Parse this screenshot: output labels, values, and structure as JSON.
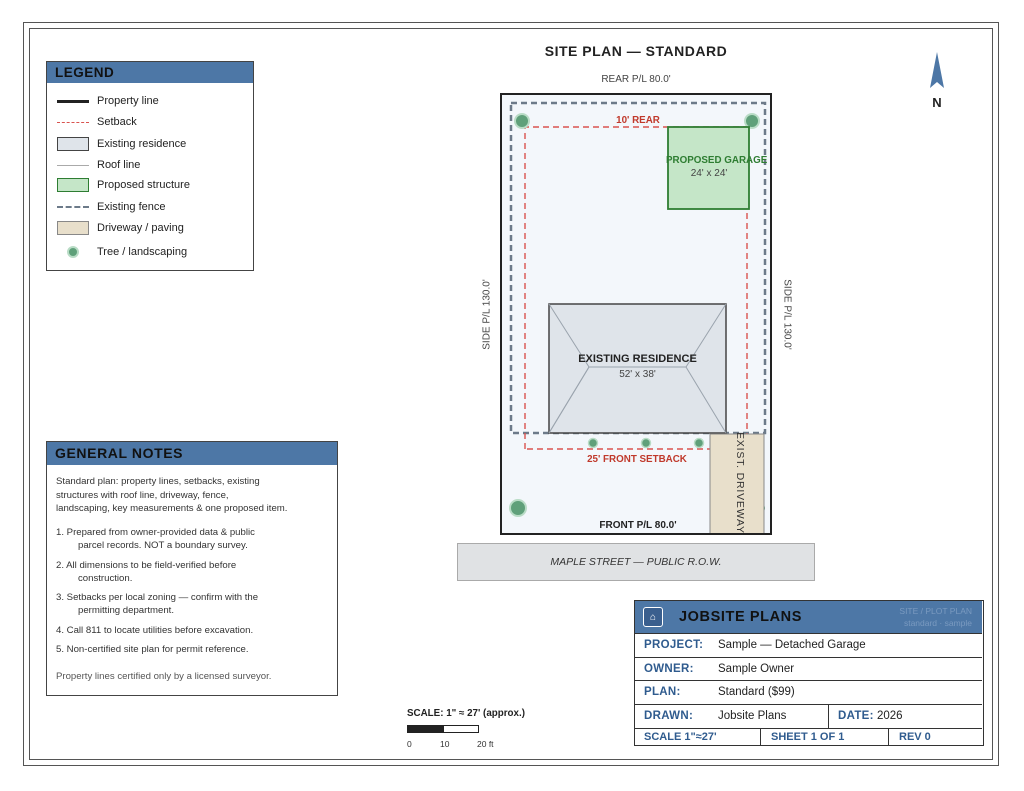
{
  "plan_title": "SITE PLAN — STANDARD",
  "lot": {
    "rear_label": "REAR P/L 80.0'",
    "front_label": "FRONT P/L 80.0'",
    "side_left_label": "SIDE P/L 130.0'",
    "side_right_label": "SIDE P/L 130.0'",
    "rear_setback_label": "10' REAR",
    "front_setback_label": "25' FRONT SETBACK"
  },
  "existing_residence": {
    "name": "EXISTING RESIDENCE",
    "dims": "52' x 38'"
  },
  "proposed_garage": {
    "name": "PROPOSED GARAGE",
    "dims": "24' x 24'"
  },
  "driveway_label": "EXIST. DRIVEWAY",
  "street_label": "MAPLE STREET — PUBLIC R.O.W.",
  "north_label": "N",
  "legend": {
    "title": "LEGEND",
    "items": [
      {
        "label": "Property line",
        "icon": "property-line"
      },
      {
        "label": "Setback",
        "icon": "setback-line"
      },
      {
        "label": "Existing residence",
        "icon": "residence-swatch"
      },
      {
        "label": "Roof line",
        "icon": "roof-line"
      },
      {
        "label": "Proposed structure",
        "icon": "proposed-swatch"
      },
      {
        "label": "Existing fence",
        "icon": "fence-line"
      },
      {
        "label": "Driveway / paving",
        "icon": "driveway-swatch"
      },
      {
        "label": "Tree / landscaping",
        "icon": "tree"
      }
    ]
  },
  "notes": {
    "title": "GENERAL NOTES",
    "intro_lines": [
      "Standard plan: property lines, setbacks, existing",
      "structures with roof line, driveway, fence,",
      "landscaping, key measurements & one proposed item."
    ],
    "items": [
      [
        "1. Prepared from owner-provided data & public",
        "parcel records. NOT a boundary survey."
      ],
      [
        "2. All dimensions to be field-verified before",
        "construction."
      ],
      [
        "3. Setbacks per local zoning — confirm with the",
        "permitting department."
      ],
      [
        "4. Call 811 to locate utilities before excavation."
      ],
      [
        "5. Non-certified site plan for permit reference."
      ]
    ],
    "footer": "Property lines certified only by a licensed surveyor."
  },
  "scale_bar": {
    "title": "SCALE: 1\" ≈ 27' (approx.)",
    "ticks": [
      "0",
      "10",
      "20 ft"
    ]
  },
  "title_block": {
    "company": "JOBSITE PLANS",
    "right_line1": "SITE / PLOT PLAN",
    "right_line2": "standard · sample",
    "rows": [
      {
        "key": "PROJECT:",
        "value": "Sample — Detached Garage"
      },
      {
        "key": "OWNER:",
        "value": "Sample Owner"
      },
      {
        "key": "PLAN:",
        "value": "Standard ($99)"
      }
    ],
    "drawn_key": "DRAWN:",
    "drawn_value": "Jobsite Plans",
    "date_key": "DATE:",
    "date_value": "2026",
    "footer": {
      "scale": "SCALE 1\"≈27'",
      "sheet": "SHEET 1 OF 1",
      "rev": "REV 0"
    }
  },
  "colors": {
    "header_blue": "#4d77a6",
    "setback_red": "#d9534f",
    "proposed_green": "#c5e6c8",
    "fence_gray": "#6c7a89",
    "driveway_tan": "#e8dfcb",
    "tree_green": "#5fa07a"
  }
}
